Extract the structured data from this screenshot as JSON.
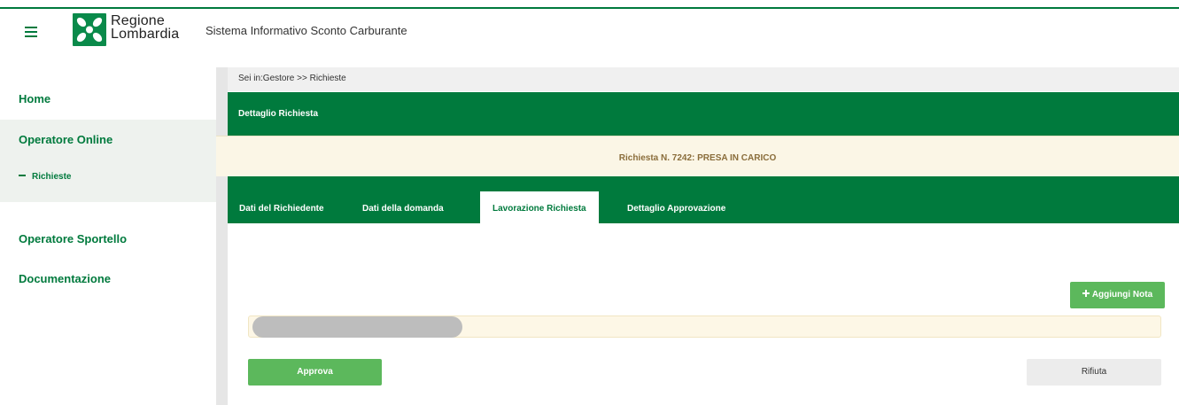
{
  "header": {
    "logo_line1": "Regione",
    "logo_line2": "Lombardia",
    "app_title": "Sistema Informativo Sconto Carburante",
    "menu_icon": "hamburger-icon",
    "logo_icon": "regione-lombardia-logo"
  },
  "sidebar": {
    "home": "Home",
    "operatore_online": "Operatore Online",
    "richieste": "Richieste",
    "operatore_sportello": "Operatore Sportello",
    "documentazione": "Documentazione"
  },
  "breadcrumb": "Sei in:Gestore >> Richieste",
  "panel": {
    "title": "Dettaglio Richiesta",
    "status": "Richiesta N. 7242: PRESA IN CARICO"
  },
  "tabs": [
    {
      "label": "Dati del Richiedente",
      "active": false
    },
    {
      "label": "Dati della domanda",
      "active": false
    },
    {
      "label": "Lavorazione Richiesta",
      "active": true
    },
    {
      "label": "Dettaglio Approvazione",
      "active": false
    }
  ],
  "actions": {
    "add_note": "Aggiungi Nota",
    "add_note_icon": "plus-icon",
    "approva": "Approva",
    "rifiuta": "Rifiuta"
  },
  "colors": {
    "brand_green": "#007a3d",
    "button_green": "#5cb85c",
    "status_bg": "#fbf6e6",
    "status_text": "#8a6d3b"
  }
}
